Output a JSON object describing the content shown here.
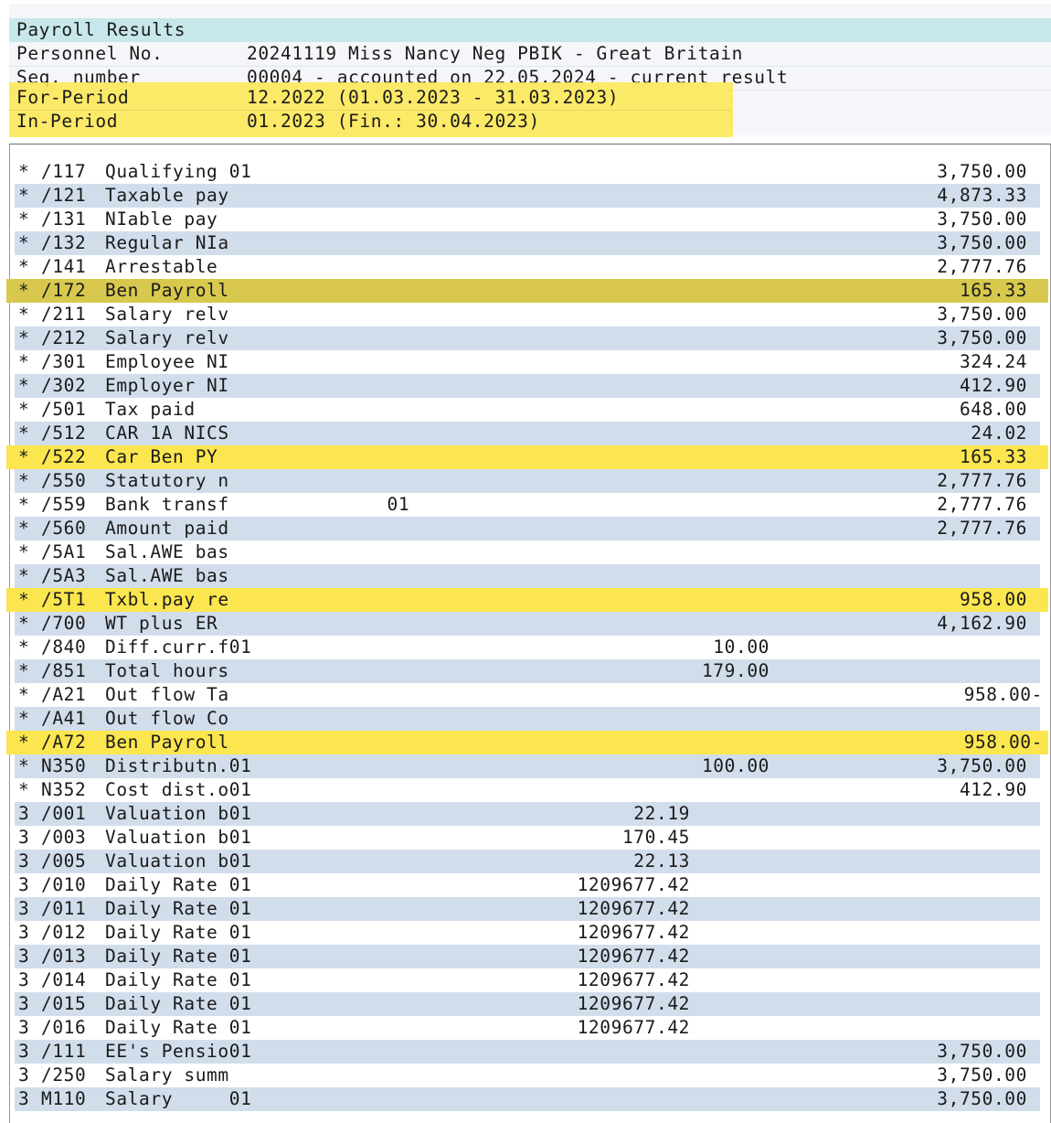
{
  "header": {
    "title": "Payroll Results",
    "fields": [
      {
        "label": "Personnel No.",
        "value": "20241119 Miss Nancy Neg PBIK - Great Britain"
      },
      {
        "label": "Seq. number",
        "value": "00004 - accounted on 22.05.2024 - current result"
      },
      {
        "label": "For-Period",
        "value": "12.2022 (01.03.2023 - 31.03.2023)"
      },
      {
        "label": "In-Period",
        "value": "01.2023 (Fin.: 30.04.2023)"
      }
    ]
  },
  "rows": [
    {
      "flag": "*",
      "wt": "/117",
      "text": "Qualifying 01",
      "rate": "",
      "num": "",
      "amount": "3,750.00",
      "hl": ""
    },
    {
      "flag": "*",
      "wt": "/121",
      "text": "Taxable pay",
      "rate": "",
      "num": "",
      "amount": "4,873.33",
      "hl": ""
    },
    {
      "flag": "*",
      "wt": "/131",
      "text": "NIable pay",
      "rate": "",
      "num": "",
      "amount": "3,750.00",
      "hl": ""
    },
    {
      "flag": "*",
      "wt": "/132",
      "text": "Regular NIa",
      "rate": "",
      "num": "",
      "amount": "3,750.00",
      "hl": ""
    },
    {
      "flag": "*",
      "wt": "/141",
      "text": "Arrestable",
      "rate": "",
      "num": "",
      "amount": "2,777.76",
      "hl": ""
    },
    {
      "flag": "*",
      "wt": "/172",
      "text": "Ben Payroll",
      "rate": "",
      "num": "",
      "amount": "165.33",
      "hl": "dark"
    },
    {
      "flag": "*",
      "wt": "/211",
      "text": "Salary relv",
      "rate": "",
      "num": "",
      "amount": "3,750.00",
      "hl": ""
    },
    {
      "flag": "*",
      "wt": "/212",
      "text": "Salary relv",
      "rate": "",
      "num": "",
      "amount": "3,750.00",
      "hl": ""
    },
    {
      "flag": "*",
      "wt": "/301",
      "text": "Employee NI",
      "rate": "",
      "num": "",
      "amount": "324.24",
      "hl": ""
    },
    {
      "flag": "*",
      "wt": "/302",
      "text": "Employer NI",
      "rate": "",
      "num": "",
      "amount": "412.90",
      "hl": ""
    },
    {
      "flag": "*",
      "wt": "/501",
      "text": "Tax paid",
      "rate": "",
      "num": "",
      "amount": "648.00",
      "hl": ""
    },
    {
      "flag": "*",
      "wt": "/512",
      "text": "CAR 1A NICS",
      "rate": "",
      "num": "",
      "amount": "24.02",
      "hl": ""
    },
    {
      "flag": "*",
      "wt": "/522",
      "text": "Car Ben PY",
      "rate": "",
      "num": "",
      "amount": "165.33",
      "hl": "yellow"
    },
    {
      "flag": "*",
      "wt": "/550",
      "text": "Statutory n",
      "rate": "",
      "num": "",
      "amount": "2,777.76",
      "hl": ""
    },
    {
      "flag": "*",
      "wt": "/559",
      "text": "Bank transf              01",
      "rate": "",
      "num": "",
      "amount": "2,777.76",
      "hl": ""
    },
    {
      "flag": "*",
      "wt": "/560",
      "text": "Amount paid",
      "rate": "",
      "num": "",
      "amount": "2,777.76",
      "hl": ""
    },
    {
      "flag": "*",
      "wt": "/5A1",
      "text": "Sal.AWE bas",
      "rate": "",
      "num": "",
      "amount": "",
      "hl": ""
    },
    {
      "flag": "*",
      "wt": "/5A3",
      "text": "Sal.AWE bas",
      "rate": "",
      "num": "",
      "amount": "",
      "hl": ""
    },
    {
      "flag": "*",
      "wt": "/5T1",
      "text": "Txbl.pay re",
      "rate": "",
      "num": "",
      "amount": "958.00",
      "hl": "yellow"
    },
    {
      "flag": "*",
      "wt": "/700",
      "text": "WT plus ER",
      "rate": "",
      "num": "",
      "amount": "4,162.90",
      "hl": ""
    },
    {
      "flag": "*",
      "wt": "/840",
      "text": "Diff.curr.f01",
      "rate": "",
      "num": "10.00",
      "amount": "",
      "hl": ""
    },
    {
      "flag": "*",
      "wt": "/851",
      "text": "Total hours",
      "rate": "",
      "num": "179.00",
      "amount": "",
      "hl": ""
    },
    {
      "flag": "*",
      "wt": "/A21",
      "text": "Out flow Ta",
      "rate": "",
      "num": "",
      "amount": "958.00-",
      "hl": ""
    },
    {
      "flag": "*",
      "wt": "/A41",
      "text": "Out flow Co",
      "rate": "",
      "num": "",
      "amount": "",
      "hl": ""
    },
    {
      "flag": "*",
      "wt": "/A72",
      "text": "Ben Payroll",
      "rate": "",
      "num": "",
      "amount": "958.00-",
      "hl": "yellow"
    },
    {
      "flag": "*",
      "wt": "N350",
      "text": "Distributn.01",
      "rate": "",
      "num": "100.00",
      "amount": "3,750.00",
      "hl": ""
    },
    {
      "flag": "*",
      "wt": "N352",
      "text": "Cost dist.o01",
      "rate": "",
      "num": "",
      "amount": "412.90",
      "hl": ""
    },
    {
      "flag": "3",
      "wt": "/001",
      "text": "Valuation b01",
      "rate": "22.19",
      "num": "",
      "amount": "",
      "hl": ""
    },
    {
      "flag": "3",
      "wt": "/003",
      "text": "Valuation b01",
      "rate": "170.45",
      "num": "",
      "amount": "",
      "hl": ""
    },
    {
      "flag": "3",
      "wt": "/005",
      "text": "Valuation b01",
      "rate": "22.13",
      "num": "",
      "amount": "",
      "hl": ""
    },
    {
      "flag": "3",
      "wt": "/010",
      "text": "Daily Rate 01",
      "rate": "1209677.42",
      "num": "",
      "amount": "",
      "hl": ""
    },
    {
      "flag": "3",
      "wt": "/011",
      "text": "Daily Rate 01",
      "rate": "1209677.42",
      "num": "",
      "amount": "",
      "hl": ""
    },
    {
      "flag": "3",
      "wt": "/012",
      "text": "Daily Rate 01",
      "rate": "1209677.42",
      "num": "",
      "amount": "",
      "hl": ""
    },
    {
      "flag": "3",
      "wt": "/013",
      "text": "Daily Rate 01",
      "rate": "1209677.42",
      "num": "",
      "amount": "",
      "hl": ""
    },
    {
      "flag": "3",
      "wt": "/014",
      "text": "Daily Rate 01",
      "rate": "1209677.42",
      "num": "",
      "amount": "",
      "hl": ""
    },
    {
      "flag": "3",
      "wt": "/015",
      "text": "Daily Rate 01",
      "rate": "1209677.42",
      "num": "",
      "amount": "",
      "hl": ""
    },
    {
      "flag": "3",
      "wt": "/016",
      "text": "Daily Rate 01",
      "rate": "1209677.42",
      "num": "",
      "amount": "",
      "hl": ""
    },
    {
      "flag": "3",
      "wt": "/111",
      "text": "EE's Pensio01",
      "rate": "",
      "num": "",
      "amount": "3,750.00",
      "hl": ""
    },
    {
      "flag": "3",
      "wt": "/250",
      "text": "Salary summ",
      "rate": "",
      "num": "",
      "amount": "3,750.00",
      "hl": ""
    },
    {
      "flag": "3",
      "wt": "M110",
      "text": "Salary     01",
      "rate": "",
      "num": "",
      "amount": "3,750.00",
      "hl": ""
    }
  ],
  "colors": {
    "title_bg": "#c8e7ea",
    "row_alt": "#d2ddec",
    "highlight": "#fbe64f",
    "highlight_dark": "#d8c84e"
  }
}
